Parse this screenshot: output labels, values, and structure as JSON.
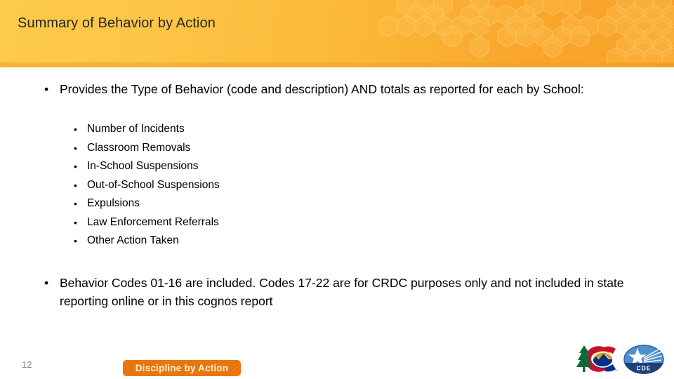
{
  "slide": {
    "title": "Summary of Behavior by Action",
    "page_number": "12"
  },
  "colors": {
    "header_left": "#fdca4a",
    "header_right": "#f8a127",
    "header_strip": "#f3aa28",
    "title_text": "#262626",
    "button_bg": "#e8760c",
    "button_text": "#fdf3e2",
    "page_number_text": "#8c8c8c",
    "body_text": "#000000"
  },
  "content": {
    "bullet_one": "Provides the Type of Behavior (code and description) AND totals as reported for each by School:",
    "sub_bullets": [
      "Number of Incidents",
      "Classroom Removals",
      "In-School Suspensions",
      "Out-of-School Suspensions",
      "Expulsions",
      "Law Enforcement Referrals",
      "Other Action Taken"
    ],
    "bullet_two": "Behavior Codes 01-16 are included.  Codes 17-22 are for CRDC purposes only and not included in state reporting online or in this cognos report",
    "bullet_mark": "•",
    "sub_bullet_mark": "•"
  },
  "footer": {
    "nav_button_label": "Discipline by Action"
  },
  "logos": {
    "colorado_name": "colorado-c-logo",
    "cde_name": "cde-logo",
    "cde_text": "CDE"
  }
}
